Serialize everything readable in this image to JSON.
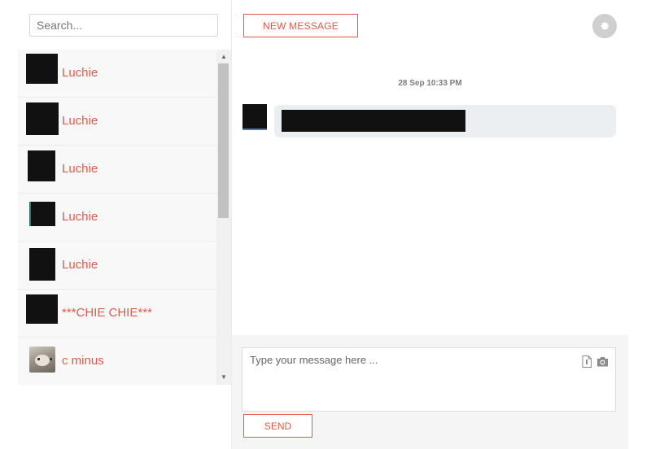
{
  "search": {
    "placeholder": "Search..."
  },
  "conversations": [
    {
      "name": "Luchie",
      "avatar": "redacted"
    },
    {
      "name": "Luchie",
      "avatar": "redacted"
    },
    {
      "name": "Luchie",
      "avatar": "redacted"
    },
    {
      "name": "Luchie",
      "avatar": "redacted"
    },
    {
      "name": "Luchie",
      "avatar": "redacted"
    },
    {
      "name": "***CHIE CHIE***",
      "avatar": "redacted"
    },
    {
      "name": "c minus",
      "avatar": "cat-photo"
    }
  ],
  "header": {
    "new_message_label": "NEW MESSAGE",
    "settings_icon": "gear-icon"
  },
  "chat": {
    "timestamp": "28 Sep 10:33 PM",
    "message_content": "redacted"
  },
  "compose": {
    "placeholder": "Type your message here ...",
    "attach_icon": "file-icon",
    "photo_icon": "camera-icon",
    "send_label": "SEND"
  },
  "colors": {
    "accent": "#e25a48",
    "bubble": "#eceff1",
    "list_background": "#f7f7f7"
  }
}
